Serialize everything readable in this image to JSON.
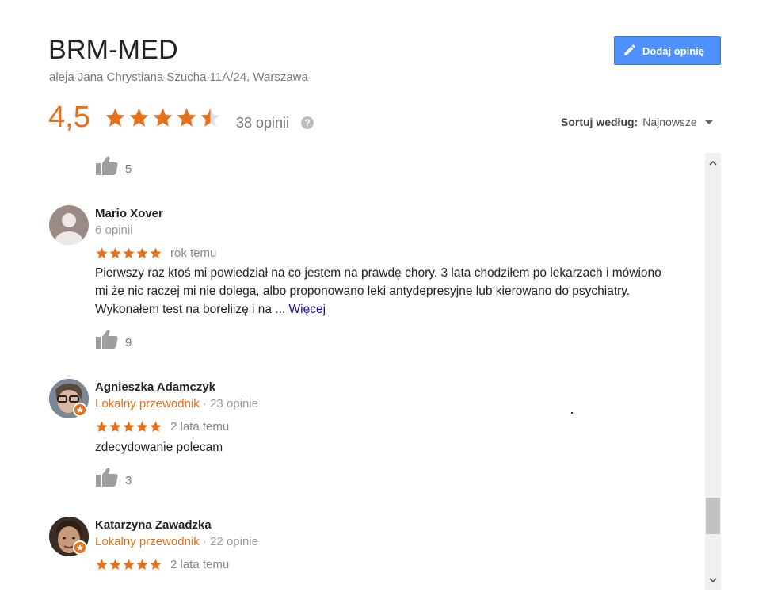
{
  "place": {
    "title": "BRM-MED",
    "address": "aleja Jana Chrystiana Szucha 11A/24, Warszawa",
    "add_review_label": "Dodaj opinię"
  },
  "summary": {
    "rating": "4,5",
    "rating_value": 4.5,
    "review_count": "38 opinii",
    "help_icon_text": "?"
  },
  "sort": {
    "label": "Sortuj według:",
    "value": "Najnowsze"
  },
  "colors": {
    "star": "#e7711b",
    "button": "#4d90fe",
    "link": "#1a0dab"
  },
  "top_likes": "5",
  "reviews": [
    {
      "name": "Mario Xover",
      "meta_plain": "6 opinii",
      "stars": 5,
      "time": "rok temu",
      "text": "Pierwszy raz ktoś mi powiedział na co jestem na prawdę chory. 3 lata chodziłem po lekarzach i mówiono mi że nic raczej mi nie dolega, albo proponowano leki antydepresyjne lub kierowano do psychiatry. Wykonałem test na boreliizę i na ...",
      "more": "Więcej",
      "likes": "9"
    },
    {
      "name": "Agnieszka Adamczyk",
      "guide": "Lokalny przewodnik",
      "separator": " · ",
      "count": "23 opinie",
      "stars": 5,
      "time": "2 lata temu",
      "text": "zdecydowanie polecam",
      "likes": "3"
    },
    {
      "name": "Katarzyna Zawadzka",
      "guide": "Lokalny przewodnik",
      "separator": " · ",
      "count": "22 opinie",
      "stars": 5,
      "time": "2 lata temu"
    }
  ]
}
